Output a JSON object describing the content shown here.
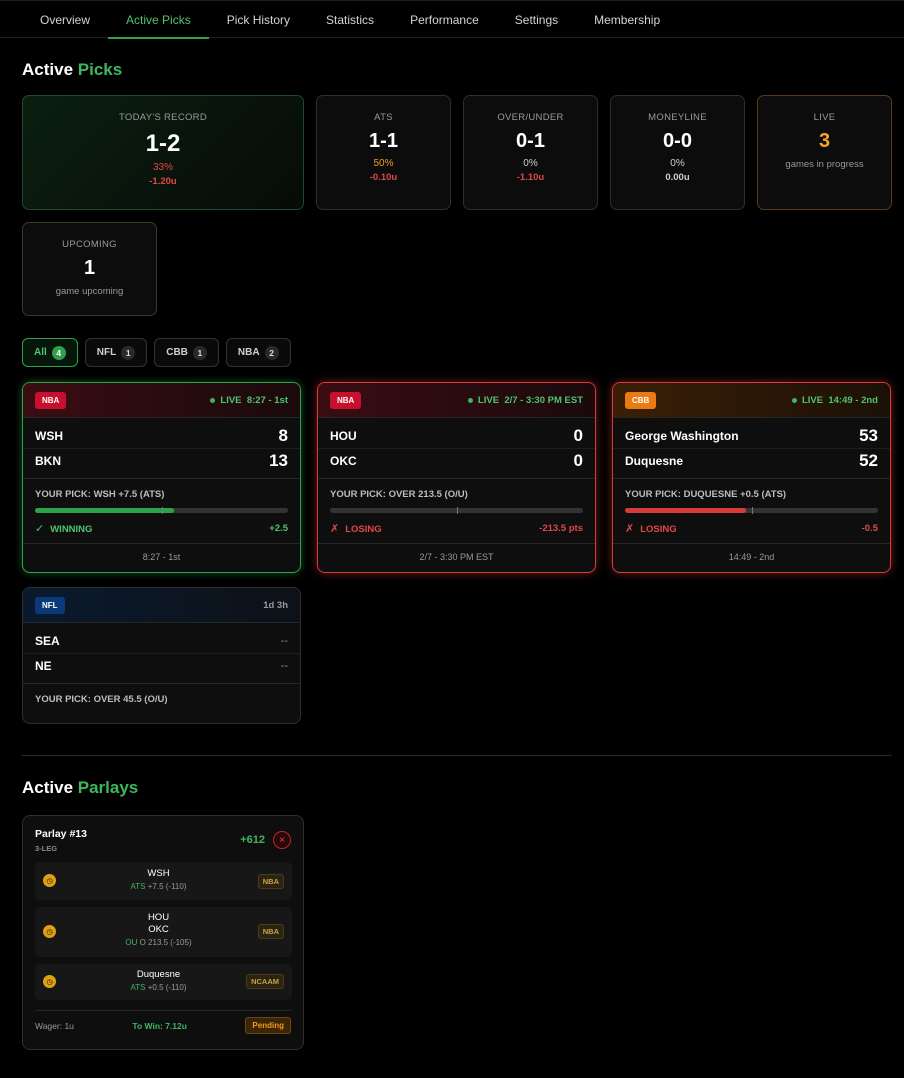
{
  "nav": {
    "tabs": [
      {
        "label": "Overview"
      },
      {
        "label": "Active Picks"
      },
      {
        "label": "Pick History"
      },
      {
        "label": "Statistics"
      },
      {
        "label": "Performance"
      },
      {
        "label": "Settings"
      },
      {
        "label": "Membership"
      }
    ],
    "active": "Active Picks"
  },
  "active_picks": {
    "title_main": "Active",
    "title_accent": "Picks"
  },
  "stats": {
    "record": {
      "label": "TODAY'S RECORD",
      "value": "1-2",
      "pct": "33%",
      "units": "-1.20u"
    },
    "ats": {
      "label": "ATS",
      "value": "1-1",
      "pct": "50%",
      "units": "-0.10u"
    },
    "ou": {
      "label": "OVER/UNDER",
      "value": "0-1",
      "pct": "0%",
      "units": "-1.10u"
    },
    "ml": {
      "label": "MONEYLINE",
      "value": "0-0",
      "pct": "0%",
      "units": "0.00u"
    },
    "live": {
      "label": "LIVE",
      "value": "3",
      "sub": "games in progress"
    },
    "upcoming": {
      "label": "UPCOMING",
      "value": "1",
      "sub": "game upcoming"
    }
  },
  "filters": [
    {
      "label": "All",
      "count": "4"
    },
    {
      "label": "NFL",
      "count": "1"
    },
    {
      "label": "CBB",
      "count": "1"
    },
    {
      "label": "NBA",
      "count": "2"
    }
  ],
  "games": [
    {
      "league": "NBA",
      "status": "LIVE",
      "time": "8:27 - 1st",
      "team1": "WSH",
      "score1": "8",
      "team2": "BKN",
      "score2": "13",
      "pick": "YOUR PICK: WSH +7.5 (ATS)",
      "progress": 0.55,
      "mark": "✓",
      "outcome": "WINNING",
      "margin": "+2.5",
      "footer": "8:27 - 1st"
    },
    {
      "league": "NBA",
      "status": "LIVE",
      "time": "2/7 - 3:30 PM EST",
      "team1": "HOU",
      "score1": "0",
      "team2": "OKC",
      "score2": "0",
      "pick": "YOUR PICK: OVER 213.5 (O/U)",
      "progress": 0,
      "mark": "✗",
      "outcome": "LOSING",
      "margin": "-213.5 pts",
      "footer": "2/7 - 3:30 PM EST"
    },
    {
      "league": "CBB",
      "status": "LIVE",
      "time": "14:49 - 2nd",
      "team1": "George Washington",
      "score1": "53",
      "team2": "Duquesne",
      "score2": "52",
      "pick": "YOUR PICK: DUQUESNE +0.5 (ATS)",
      "progress": 0.48,
      "mark": "✗",
      "outcome": "LOSING",
      "margin": "-0.5",
      "footer": "14:49 - 2nd"
    },
    {
      "league": "NFL",
      "time": "1d 3h",
      "team1": "SEA",
      "score1": "--",
      "team2": "NE",
      "score2": "--",
      "pick": "YOUR PICK: OVER 45.5 (O/U)"
    }
  ],
  "parlays_section": {
    "title_main": "Active",
    "title_accent": "Parlays"
  },
  "parlay": {
    "name": "Parlay #13",
    "legs_label": "3-LEG",
    "odds": "+612",
    "close": "×",
    "legs": [
      {
        "teams": [
          "WSH"
        ],
        "market": "ATS",
        "line": "+7.5 (-110)",
        "tag": "NBA"
      },
      {
        "teams": [
          "HOU",
          "OKC"
        ],
        "market": "OU",
        "line": "O 213.5 (-105)",
        "tag": "NBA"
      },
      {
        "teams": [
          "Duquesne"
        ],
        "market": "ATS",
        "line": "+0.5 (-110)",
        "tag": "NCAAM"
      }
    ],
    "wager": "Wager: 1u",
    "to_win": "To Win: 7.12u",
    "status": "Pending"
  },
  "colors": {
    "accent": "#3fb55e",
    "win": "#2fa14d",
    "lose": "#d93a3a",
    "live_orange": "#f5a623",
    "pending": "#f29a1c"
  }
}
